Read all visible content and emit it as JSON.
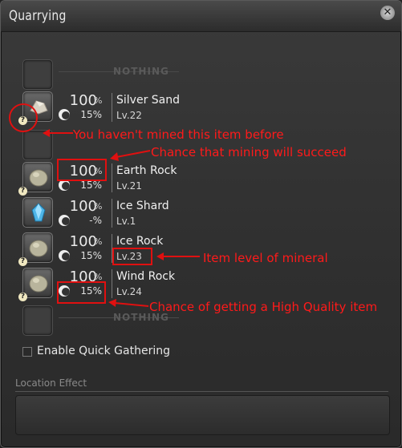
{
  "window": {
    "title": "Quarrying",
    "close_icon": "close-icon"
  },
  "slots": [
    {
      "type": "empty",
      "label": "NOTHING"
    },
    {
      "type": "item",
      "name": "Silver Sand",
      "success": "100",
      "hq": "15%",
      "level": "Lv.22",
      "unknown": true,
      "icon": "sand-icon"
    },
    {
      "type": "empty",
      "label": "NOTHING"
    },
    {
      "type": "item",
      "name": "Earth Rock",
      "success": "100",
      "hq": "15%",
      "level": "Lv.21",
      "unknown": true,
      "icon": "rock-icon"
    },
    {
      "type": "item",
      "name": "Ice Shard",
      "success": "100",
      "hq": "-%",
      "level": "Lv.1",
      "unknown": false,
      "icon": "crystal-icon"
    },
    {
      "type": "item",
      "name": "Ice Rock",
      "success": "100",
      "hq": "15%",
      "level": "Lv.23",
      "unknown": true,
      "icon": "rock-icon"
    },
    {
      "type": "item",
      "name": "Wind Rock",
      "success": "100",
      "hq": "15%",
      "level": "Lv.24",
      "unknown": true,
      "icon": "rock-icon"
    },
    {
      "type": "empty",
      "label": "NOTHING"
    }
  ],
  "percent_sign": "%",
  "unknown_marker": "?",
  "annotations": {
    "not_mined": "You haven't mined this item before",
    "chance_success": "Chance that mining will succeed",
    "item_level": "Item level of mineral",
    "hq_chance": "Chance of getting a High Quality item"
  },
  "quick_gathering": {
    "label": "Enable Quick Gathering",
    "checked": false
  },
  "location_effect": {
    "label": "Location Effect"
  },
  "colors": {
    "annotation": "#ff1a1a",
    "background": "#333333"
  }
}
